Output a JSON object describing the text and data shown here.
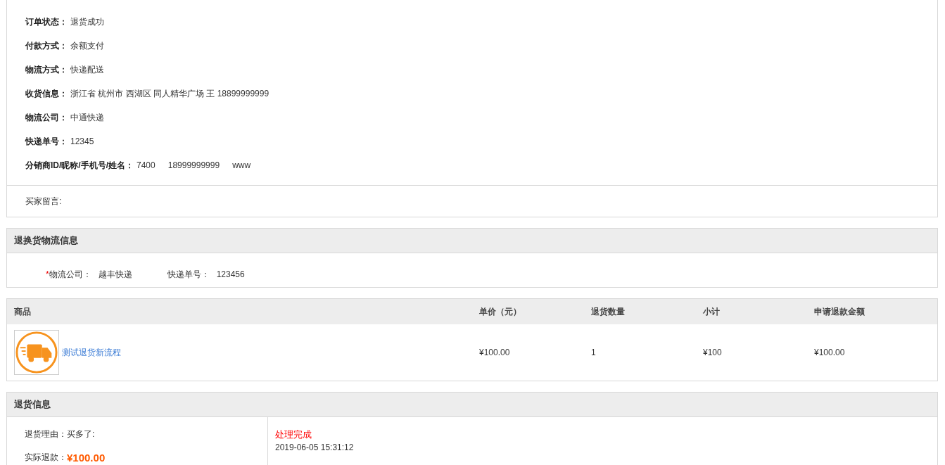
{
  "order_info": {
    "rows": [
      {
        "label": "订单状态：",
        "values": [
          "退货成功"
        ]
      },
      {
        "label": "付款方式：",
        "values": [
          "余额支付"
        ]
      },
      {
        "label": "物流方式：",
        "values": [
          "快递配送"
        ]
      },
      {
        "label": "收货信息：",
        "values": [
          "浙江省 杭州市 西湖区 同人精华广场 王 18899999999"
        ]
      },
      {
        "label": "物流公司：",
        "values": [
          "中通快递"
        ]
      },
      {
        "label": "快递单号：",
        "values": [
          "12345"
        ]
      },
      {
        "label": "分销商ID/昵称/手机号/姓名：",
        "values": [
          "7400",
          "18999999999",
          "www"
        ]
      }
    ],
    "buyer_message": {
      "label": "买家留言:"
    }
  },
  "return_logistics": {
    "title": "退换货物流信息",
    "required_mark": "*",
    "company_label": "物流公司：",
    "company": "越丰快递",
    "tracking_label": "快递单号：",
    "tracking": "123456"
  },
  "products": {
    "columns": [
      "商品",
      "单价（元）",
      "退货数量",
      "小计",
      "申请退款金额"
    ],
    "rows": [
      {
        "name": "测试退货新流程",
        "price": "¥100.00",
        "quantity": "1",
        "subtotal": "¥100",
        "refund": "¥100.00"
      }
    ]
  },
  "return_info": {
    "title": "退货信息",
    "reason_label": "退货理由：",
    "reason": "买多了:",
    "refund_label": "实际退款：",
    "refund": "¥100.00",
    "status": "处理完成",
    "time": "2019-06-05 15:31:12"
  }
}
